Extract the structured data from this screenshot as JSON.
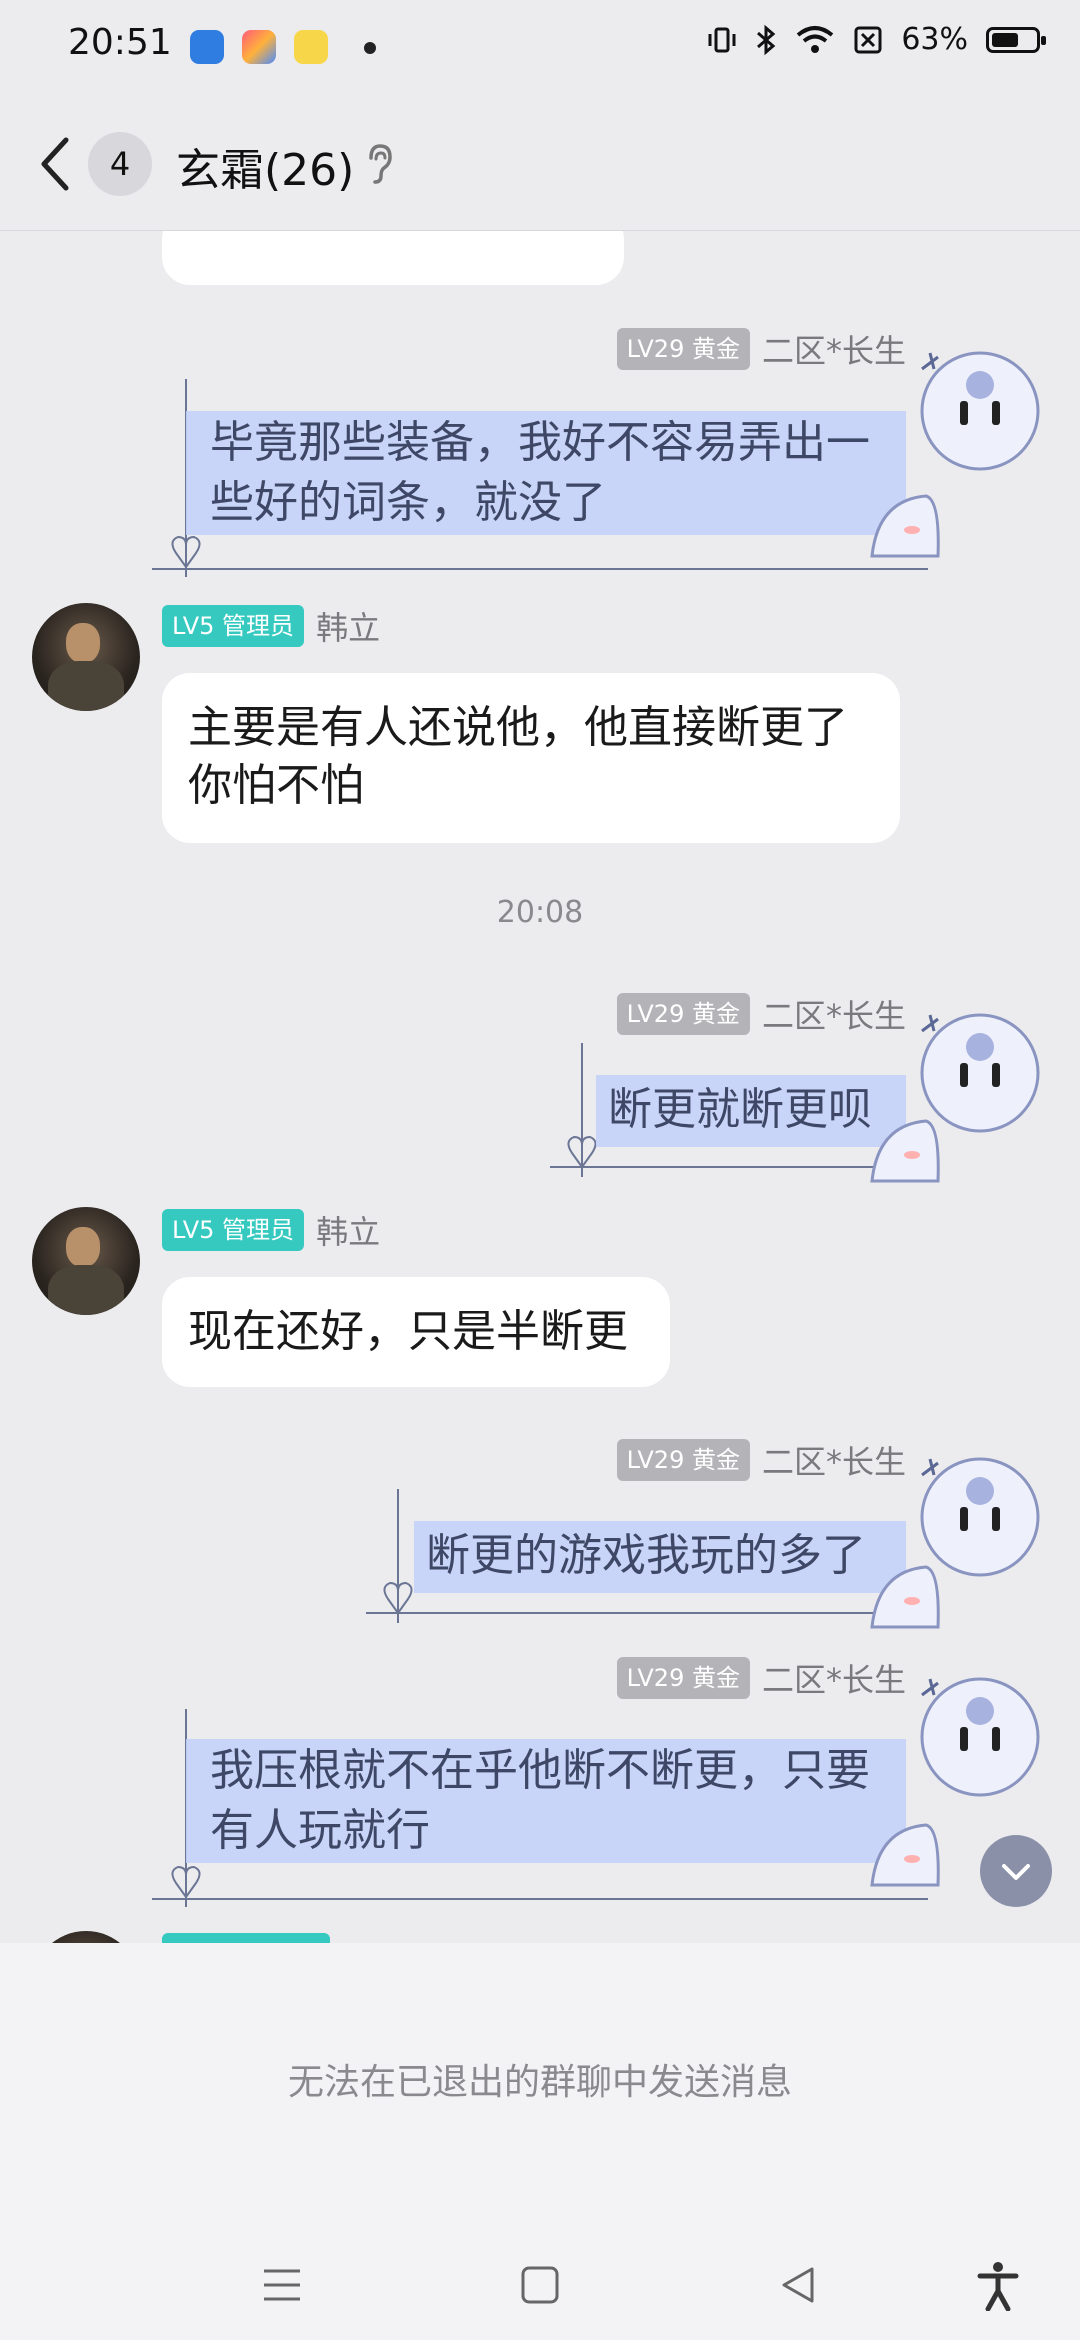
{
  "status_bar": {
    "time": "20:51",
    "battery_percent": "63%",
    "battery_level": 0.63,
    "icons": [
      "vibrate-icon",
      "bluetooth-icon",
      "wifi-icon",
      "sim-blocked-icon",
      "battery-icon"
    ]
  },
  "header": {
    "unread_count": "4",
    "title": "玄霜(26)"
  },
  "badges": {
    "gold": "LV29 黄金",
    "admin": "LV5 管理员"
  },
  "senders": {
    "self": "二区*长生",
    "other": "韩立"
  },
  "messages": [
    {
      "text": "毕竟那些装备，我好不容易弄出一些好的词条，就没了"
    },
    {
      "text": "主要是有人还说他，他直接断更了你怕不怕"
    },
    {
      "text": "断更就断更呗"
    },
    {
      "text": "现在还好，只是半断更"
    },
    {
      "text": "断更的游戏我玩的多了"
    },
    {
      "text": "我压根就不在乎他断不断更，只要有人玩就行"
    }
  ],
  "timestamp": "20:08",
  "footer": {
    "notice": "无法在已退出的群聊中发送消息"
  },
  "colors": {
    "self_bubble": "#c4d2f8",
    "admin_badge": "#35c9c0",
    "gold_badge": "#b4b4b8"
  }
}
